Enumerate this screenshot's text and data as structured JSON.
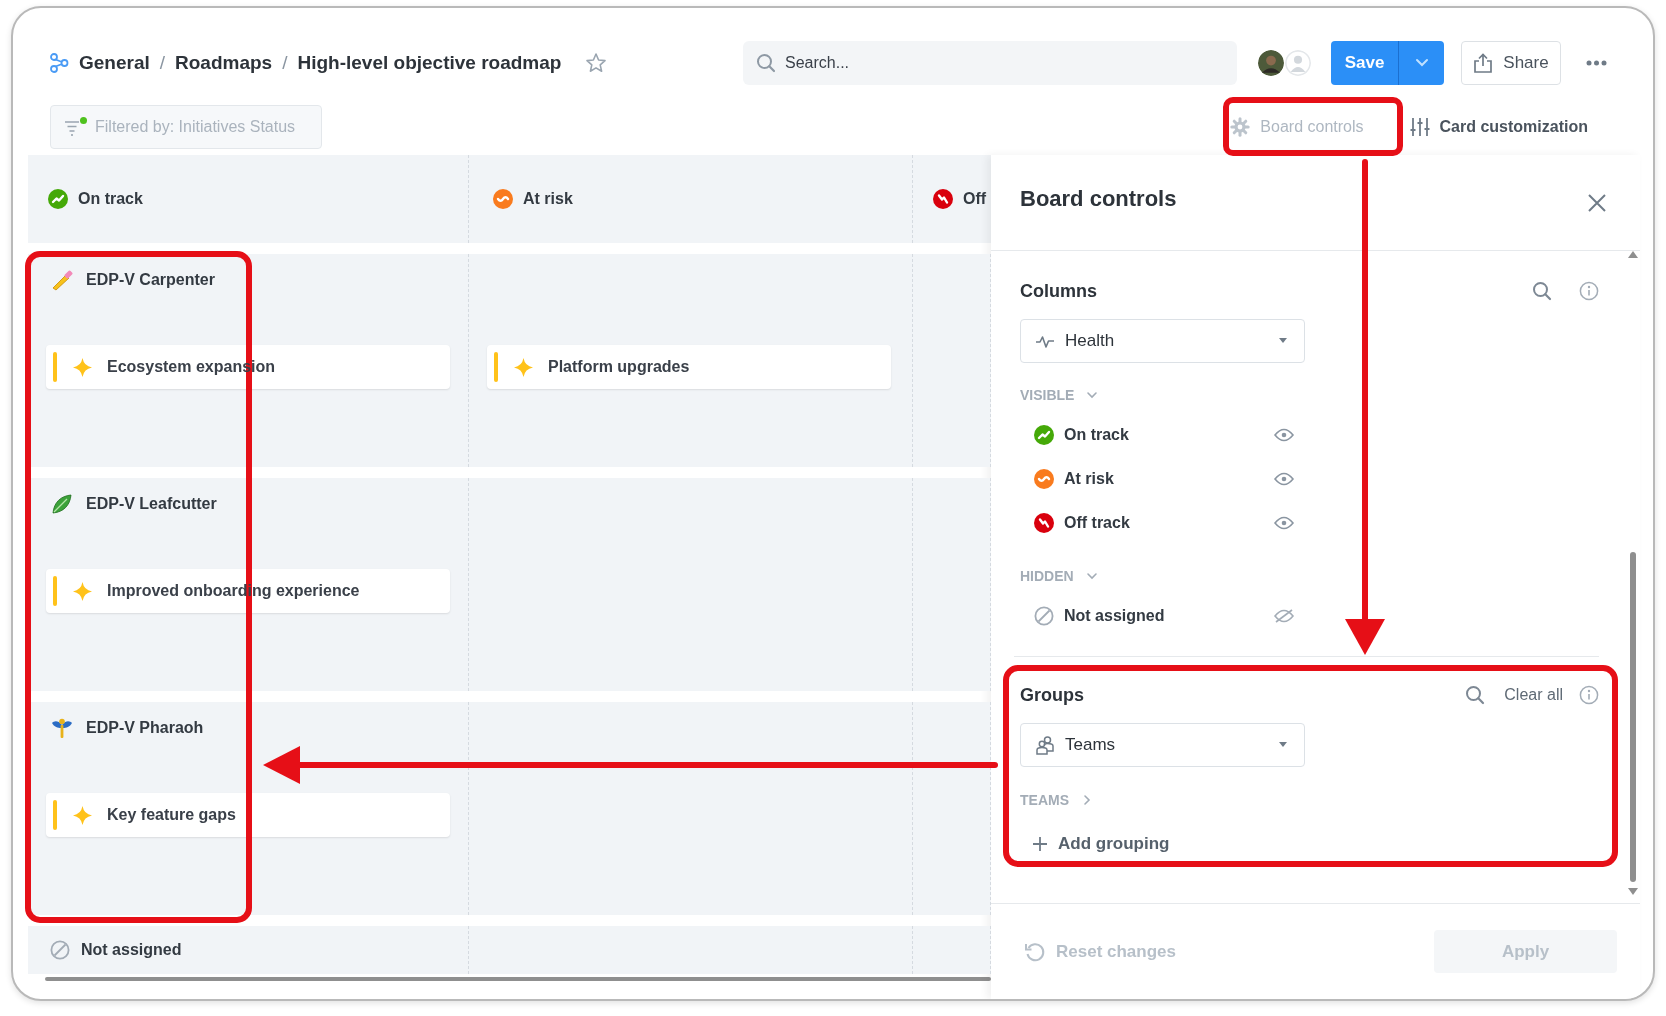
{
  "breadcrumb": {
    "separator": "/",
    "items": [
      {
        "label": "General"
      },
      {
        "label": "Roadmaps"
      },
      {
        "label": "High-level objective roadmap"
      }
    ],
    "starred": false
  },
  "search": {
    "placeholder": "Search..."
  },
  "save_button": {
    "label": "Save"
  },
  "share_button": {
    "label": "Share"
  },
  "filter": {
    "label": "Filtered by: Initiatives Status",
    "active": true
  },
  "view_controls": [
    {
      "label": "Board controls",
      "selected": true
    },
    {
      "label": "Card customization",
      "selected": false
    }
  ],
  "board": {
    "columns": [
      {
        "label": "On track",
        "kind": "on_track"
      },
      {
        "label": "At risk",
        "kind": "at_risk"
      },
      {
        "label": "Off",
        "kind": "off_track"
      }
    ],
    "groups": [
      {
        "label": "EDP-V Carpenter",
        "cards": [
          {
            "title": "Ecosystem expansion",
            "kind": "on_track"
          },
          {
            "title": "Platform upgrades",
            "kind": "at_risk"
          }
        ]
      },
      {
        "label": "EDP-V Leafcutter",
        "cards": [
          {
            "title": "Improved onboarding experience",
            "kind": "on_track"
          }
        ]
      },
      {
        "label": "EDP-V Pharaoh",
        "cards": [
          {
            "title": "Key feature gaps",
            "kind": "on_track"
          }
        ]
      }
    ],
    "unassigned": {
      "label": "Not assigned",
      "kind": "none"
    }
  },
  "panel": {
    "title": "Board controls",
    "columns_section": {
      "title": "Columns",
      "field": {
        "label": "Health"
      },
      "lists": [
        {
          "heading": "VISIBLE",
          "expanded": true,
          "items": [
            {
              "label": "On track",
              "kind": "on_track",
              "visible": true
            },
            {
              "label": "At risk",
              "kind": "at_risk",
              "visible": true
            },
            {
              "label": "Off track",
              "kind": "off_track",
              "visible": true
            }
          ]
        },
        {
          "heading": "HIDDEN",
          "expanded": true,
          "items": [
            {
              "label": "Not assigned",
              "kind": "none",
              "visible": false
            }
          ]
        }
      ]
    },
    "groups_section": {
      "title": "Groups",
      "clear_label": "Clear all",
      "field": {
        "label": "Teams"
      },
      "lists": [
        {
          "heading": "TEAMS",
          "expanded": false
        }
      ],
      "add_label": "Add grouping"
    },
    "footer": {
      "reset_label": "Reset changes",
      "reset_disabled": true,
      "apply_label": "Apply",
      "apply_disabled": true
    }
  }
}
